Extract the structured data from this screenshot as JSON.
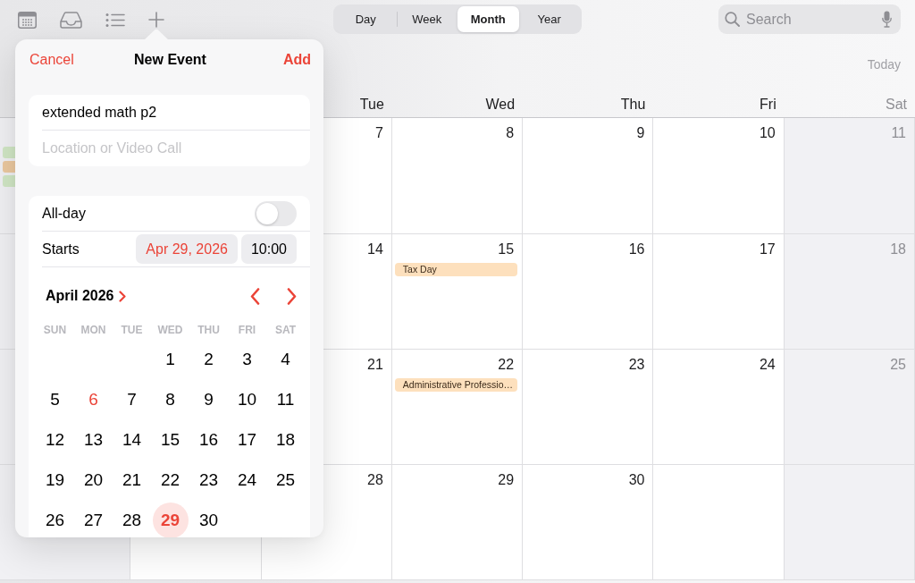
{
  "view_switcher": [
    {
      "label": "Day",
      "selected": false
    },
    {
      "label": "Week",
      "selected": false
    },
    {
      "label": "Month",
      "selected": true
    },
    {
      "label": "Year",
      "selected": false
    }
  ],
  "search": {
    "placeholder": "Search"
  },
  "today_button": "Today",
  "month_grid": {
    "weekday_headers": [
      {
        "label": "Tue",
        "weekend": false
      },
      {
        "label": "Wed",
        "weekend": false
      },
      {
        "label": "Thu",
        "weekend": false
      },
      {
        "label": "Fri",
        "weekend": false
      },
      {
        "label": "Sat",
        "weekend": true
      }
    ],
    "weeks": [
      {
        "days": [
          {
            "weekend": true,
            "events": [
              {
                "color": "#d1e7c5"
              },
              {
                "color": "#ecc9a0"
              },
              {
                "color": "#d1e7c5"
              }
            ]
          },
          {
            "date": "7",
            "weekend": false
          },
          {
            "date": "8",
            "weekend": false
          },
          {
            "date": "9",
            "weekend": false
          },
          {
            "date": "10",
            "weekend": false
          },
          {
            "date": "11",
            "weekend": true
          }
        ]
      },
      {
        "days": [
          {
            "weekend": true
          },
          {
            "date": "14",
            "weekend": false
          },
          {
            "date": "15",
            "weekend": false,
            "events": [
              {
                "title": "Tax Day",
                "color": "#fde0bd"
              }
            ]
          },
          {
            "date": "16",
            "weekend": false
          },
          {
            "date": "17",
            "weekend": false
          },
          {
            "date": "18",
            "weekend": true
          }
        ]
      },
      {
        "days": [
          {
            "weekend": true
          },
          {
            "date": "21",
            "weekend": false
          },
          {
            "date": "22",
            "weekend": false,
            "events": [
              {
                "title": "Administrative Professio…",
                "color": "#fde0bd"
              }
            ]
          },
          {
            "date": "23",
            "weekend": false
          },
          {
            "date": "24",
            "weekend": false
          },
          {
            "date": "25",
            "weekend": true
          }
        ]
      },
      {
        "days": [
          {
            "weekend": true
          },
          {
            "weekend": false
          },
          {
            "date": "28",
            "weekend": false
          },
          {
            "date": "29",
            "weekend": false
          },
          {
            "date": "30",
            "weekend": false
          },
          {
            "weekend": false
          },
          {
            "weekend": true
          }
        ]
      }
    ]
  },
  "new_event_popover": {
    "cancel": "Cancel",
    "title": "New Event",
    "add": "Add",
    "title_field": {
      "value": "extended math p2"
    },
    "location_field": {
      "placeholder": "Location or Video Call"
    },
    "all_day": {
      "label": "All-day",
      "on": false
    },
    "starts": {
      "label": "Starts",
      "date": "Apr 29, 2026",
      "time": "10:00",
      "date_expanded": true
    },
    "date_picker": {
      "month": "April 2026",
      "weekdays": [
        "SUN",
        "MON",
        "TUE",
        "WED",
        "THU",
        "FRI",
        "SAT"
      ],
      "weeks": [
        {
          "days": [
            {
              "day": "1",
              "today": false,
              "selected": false
            },
            {
              "day": "2",
              "today": false,
              "selected": false
            },
            {
              "day": "3",
              "today": false,
              "selected": false
            },
            {
              "day": "4",
              "today": false,
              "selected": false
            }
          ]
        },
        {
          "days": [
            {
              "day": "5",
              "today": false,
              "selected": false
            },
            {
              "day": "6",
              "today": true,
              "selected": false
            },
            {
              "day": "7",
              "today": false,
              "selected": false
            },
            {
              "day": "8",
              "today": false,
              "selected": false
            },
            {
              "day": "9",
              "today": false,
              "selected": false
            },
            {
              "day": "10",
              "today": false,
              "selected": false
            },
            {
              "day": "11",
              "today": false,
              "selected": false
            }
          ]
        },
        {
          "days": [
            {
              "day": "12",
              "today": false,
              "selected": false
            },
            {
              "day": "13",
              "today": false,
              "selected": false
            },
            {
              "day": "14",
              "today": false,
              "selected": false
            },
            {
              "day": "15",
              "today": false,
              "selected": false
            },
            {
              "day": "16",
              "today": false,
              "selected": false
            },
            {
              "day": "17",
              "today": false,
              "selected": false
            },
            {
              "day": "18",
              "today": false,
              "selected": false
            }
          ]
        },
        {
          "days": [
            {
              "day": "19",
              "today": false,
              "selected": false
            },
            {
              "day": "20",
              "today": false,
              "selected": false
            },
            {
              "day": "21",
              "today": false,
              "selected": false
            },
            {
              "day": "22",
              "today": false,
              "selected": false
            },
            {
              "day": "23",
              "today": false,
              "selected": false
            },
            {
              "day": "24",
              "today": false,
              "selected": false
            },
            {
              "day": "25",
              "today": false,
              "selected": false
            }
          ]
        },
        {
          "days": [
            {
              "day": "26",
              "today": false,
              "selected": false
            },
            {
              "day": "27",
              "today": false,
              "selected": false
            },
            {
              "day": "28",
              "today": false,
              "selected": false
            },
            {
              "day": "29",
              "today": false,
              "selected": true
            },
            {
              "day": "30",
              "today": false,
              "selected": false
            }
          ]
        }
      ]
    }
  }
}
